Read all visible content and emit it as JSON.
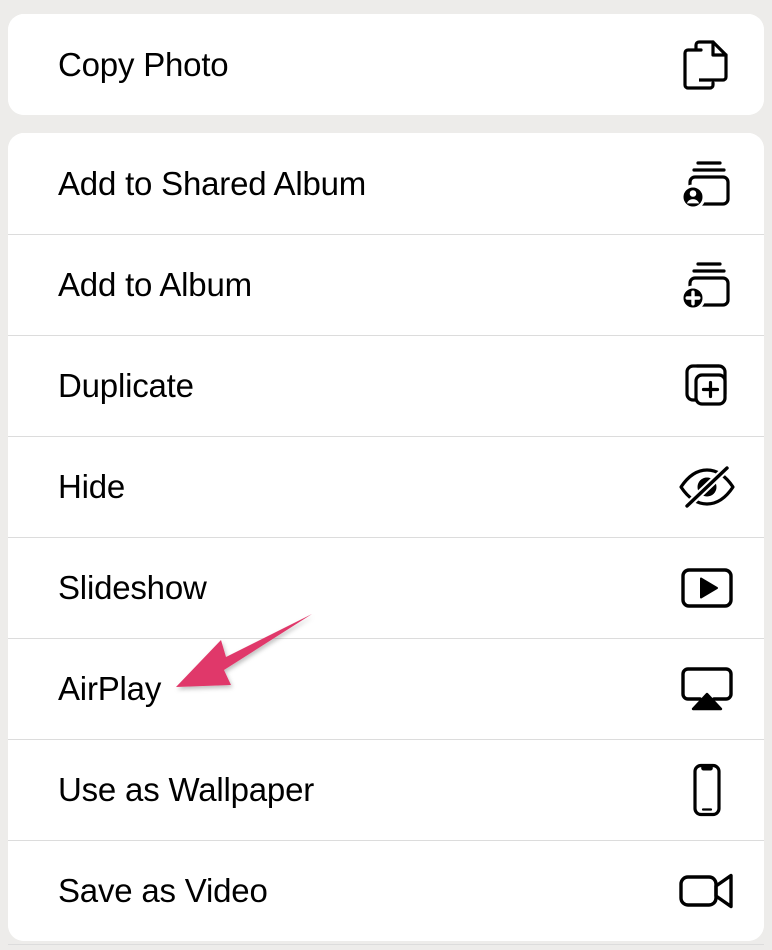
{
  "screen": {
    "app": "Photos",
    "surface": "photo-action-menu",
    "background_color": "#edecea",
    "card_color": "#ffffff",
    "separator_color": "#dcdcdc",
    "text_color": "#000000"
  },
  "groups": [
    {
      "group_name": "copy-group",
      "items": [
        {
          "label": "Copy Photo",
          "icon": "copy-documents-icon"
        }
      ]
    },
    {
      "group_name": "photo-actions-group",
      "items": [
        {
          "label": "Add to Shared Album",
          "icon": "shared-album-person-icon"
        },
        {
          "label": "Add to Album",
          "icon": "album-plus-icon"
        },
        {
          "label": "Duplicate",
          "icon": "duplicate-plus-icon"
        },
        {
          "label": "Hide",
          "icon": "eye-slash-icon"
        },
        {
          "label": "Slideshow",
          "icon": "play-rectangle-icon"
        },
        {
          "label": "AirPlay",
          "icon": "airplay-icon"
        },
        {
          "label": "Use as Wallpaper",
          "icon": "iphone-icon"
        },
        {
          "label": "Save as Video",
          "icon": "video-camera-icon"
        }
      ]
    }
  ],
  "annotation": {
    "name": "pointer-arrow",
    "color": "#e0386a",
    "points_at": "AirPlay",
    "direction": "down-left"
  }
}
